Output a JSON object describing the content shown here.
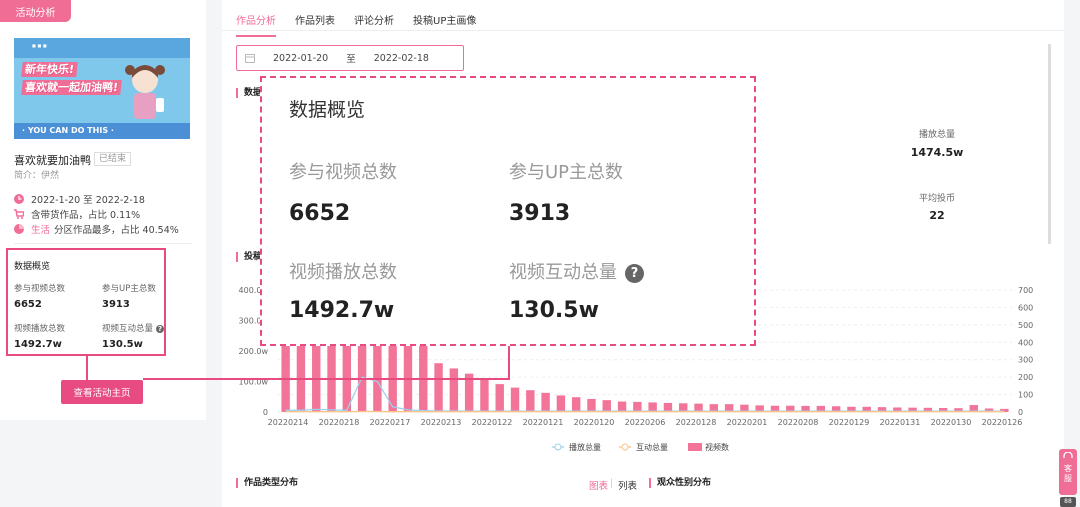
{
  "left": {
    "activity_tag": "活动分析",
    "banner": {
      "line1": "新年快乐!",
      "line2": "喜欢就一起加油鸭!",
      "bottom": "· YOU CAN DO THIS ·"
    },
    "title": "喜欢就要加油鸭",
    "status": "已结束",
    "brief": "简介：伊然",
    "dates": "2022-1-20 至 2022-2-18",
    "cargo": "含带货作品，占比 0.11%",
    "zone_highlight": "生活",
    "zone_text": "分区作品最多，占比 40.54%",
    "overview": {
      "title": "数据概览",
      "videos_label": "参与视频总数",
      "videos_value": "6652",
      "ups_label": "参与UP主总数",
      "ups_value": "3913",
      "plays_label": "视频播放总数",
      "plays_value": "1492.7w",
      "interact_label": "视频互动总量",
      "interact_value": "130.5w"
    },
    "view_button": "查看活动主页"
  },
  "main": {
    "tabs": [
      "作品分析",
      "作品列表",
      "评论分析",
      "投稿UP主画像"
    ],
    "date_start": "2022-01-20",
    "date_sep": "至",
    "date_end": "2022-02-18",
    "section_data": "数据",
    "stats": [
      {
        "label": "播放总量",
        "value": "1474.5w"
      },
      {
        "label": "平均投币",
        "value": "22"
      }
    ],
    "section_trend": "投稿",
    "section_type": "作品类型分布",
    "view_chart": "图表",
    "view_sep": "|",
    "view_list": "列表",
    "section_gender": "观众性别分布"
  },
  "callout": {
    "title": "数据概览",
    "videos_label": "参与视频总数",
    "videos_value": "6652",
    "ups_label": "参与UP主总数",
    "ups_value": "3913",
    "plays_label": "视频播放总数",
    "plays_value": "1492.7w",
    "interact_label": "视频互动总量",
    "interact_value": "130.5w",
    "help_icon": "?"
  },
  "widget": {
    "label": "客服",
    "mini": "88"
  },
  "chart_data": {
    "type": "bar",
    "categories": [
      "20220214",
      "20220218",
      "20220217",
      "20220213",
      "20220122",
      "20220121",
      "20220120",
      "20220206",
      "20220128",
      "20220201",
      "20220208",
      "20220129",
      "20220131",
      "20220130",
      "20220126"
    ],
    "left_ticks": [
      "400.0w",
      "300.0w",
      "200.0w",
      "100.0w",
      "0"
    ],
    "right_ticks": [
      "700",
      "600",
      "500",
      "400",
      "300",
      "200",
      "100",
      "0"
    ],
    "ylim_right": [
      0,
      700
    ],
    "series": [
      {
        "name": "视频数",
        "values": [
          700,
          700,
          700,
          700,
          700,
          700,
          700,
          700,
          700,
          700,
          280,
          250,
          220,
          190,
          160,
          140,
          125,
          110,
          95,
          85,
          75,
          68,
          60,
          58,
          55,
          52,
          50,
          48,
          45,
          45,
          42,
          38,
          36,
          36,
          35,
          35,
          33,
          30,
          30,
          28,
          26,
          25,
          24,
          23,
          22,
          40,
          20,
          18
        ]
      },
      {
        "name": "播放总量",
        "values": [
          10,
          10,
          15,
          12,
          10,
          200,
          175,
          30,
          12,
          8,
          6,
          6,
          5,
          5,
          5,
          5,
          5,
          5,
          5,
          5,
          5,
          5,
          5,
          5,
          5,
          5,
          5,
          5,
          5,
          5,
          5,
          5,
          5,
          5,
          5,
          5,
          5,
          5,
          5,
          5,
          5,
          5,
          5,
          5,
          5,
          5,
          5,
          5
        ]
      },
      {
        "name": "互动总量",
        "values": [
          2,
          2,
          2,
          2,
          2,
          3,
          3,
          2,
          2,
          2,
          2,
          2,
          2,
          2,
          2,
          2,
          2,
          2,
          2,
          2,
          2,
          2,
          2,
          2,
          2,
          2,
          2,
          2,
          2,
          2,
          2,
          2,
          2,
          2,
          2,
          2,
          2,
          2,
          2,
          2,
          2,
          2,
          2,
          2,
          2,
          2,
          2,
          2
        ]
      }
    ],
    "legend": [
      "播放总量",
      "互动总量",
      "视频数"
    ],
    "colors": {
      "bars": "#f27599",
      "play_line": "#9fd0ec",
      "interact_line": "#f9c38a"
    }
  },
  "colors": {
    "accent": "#f06d96",
    "accent_dark": "#e84a82"
  }
}
